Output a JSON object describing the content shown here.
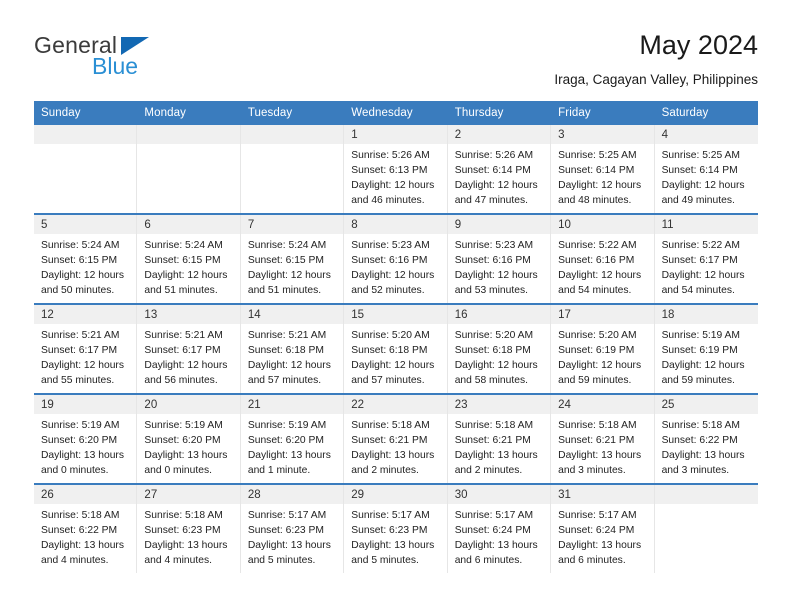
{
  "logo": {
    "line1": "General",
    "line2": "Blue",
    "triangle_color": "#1268b3",
    "blue_color": "#2a8fd4"
  },
  "header": {
    "title": "May 2024",
    "subtitle": "Iraga, Cagayan Valley, Philippines"
  },
  "theme": {
    "header_blue": "#3a7cbe",
    "date_band_gray": "#f0f0f0",
    "cell_border": "#e6e6e6"
  },
  "weekdays": [
    "Sunday",
    "Monday",
    "Tuesday",
    "Wednesday",
    "Thursday",
    "Friday",
    "Saturday"
  ],
  "weeks": [
    [
      {
        "day": "",
        "empty": true
      },
      {
        "day": "",
        "empty": true
      },
      {
        "day": "",
        "empty": true
      },
      {
        "day": "1",
        "sunrise": "Sunrise: 5:26 AM",
        "sunset": "Sunset: 6:13 PM",
        "daylight1": "Daylight: 12 hours",
        "daylight2": "and 46 minutes."
      },
      {
        "day": "2",
        "sunrise": "Sunrise: 5:26 AM",
        "sunset": "Sunset: 6:14 PM",
        "daylight1": "Daylight: 12 hours",
        "daylight2": "and 47 minutes."
      },
      {
        "day": "3",
        "sunrise": "Sunrise: 5:25 AM",
        "sunset": "Sunset: 6:14 PM",
        "daylight1": "Daylight: 12 hours",
        "daylight2": "and 48 minutes."
      },
      {
        "day": "4",
        "sunrise": "Sunrise: 5:25 AM",
        "sunset": "Sunset: 6:14 PM",
        "daylight1": "Daylight: 12 hours",
        "daylight2": "and 49 minutes."
      }
    ],
    [
      {
        "day": "5",
        "sunrise": "Sunrise: 5:24 AM",
        "sunset": "Sunset: 6:15 PM",
        "daylight1": "Daylight: 12 hours",
        "daylight2": "and 50 minutes."
      },
      {
        "day": "6",
        "sunrise": "Sunrise: 5:24 AM",
        "sunset": "Sunset: 6:15 PM",
        "daylight1": "Daylight: 12 hours",
        "daylight2": "and 51 minutes."
      },
      {
        "day": "7",
        "sunrise": "Sunrise: 5:24 AM",
        "sunset": "Sunset: 6:15 PM",
        "daylight1": "Daylight: 12 hours",
        "daylight2": "and 51 minutes."
      },
      {
        "day": "8",
        "sunrise": "Sunrise: 5:23 AM",
        "sunset": "Sunset: 6:16 PM",
        "daylight1": "Daylight: 12 hours",
        "daylight2": "and 52 minutes."
      },
      {
        "day": "9",
        "sunrise": "Sunrise: 5:23 AM",
        "sunset": "Sunset: 6:16 PM",
        "daylight1": "Daylight: 12 hours",
        "daylight2": "and 53 minutes."
      },
      {
        "day": "10",
        "sunrise": "Sunrise: 5:22 AM",
        "sunset": "Sunset: 6:16 PM",
        "daylight1": "Daylight: 12 hours",
        "daylight2": "and 54 minutes."
      },
      {
        "day": "11",
        "sunrise": "Sunrise: 5:22 AM",
        "sunset": "Sunset: 6:17 PM",
        "daylight1": "Daylight: 12 hours",
        "daylight2": "and 54 minutes."
      }
    ],
    [
      {
        "day": "12",
        "sunrise": "Sunrise: 5:21 AM",
        "sunset": "Sunset: 6:17 PM",
        "daylight1": "Daylight: 12 hours",
        "daylight2": "and 55 minutes."
      },
      {
        "day": "13",
        "sunrise": "Sunrise: 5:21 AM",
        "sunset": "Sunset: 6:17 PM",
        "daylight1": "Daylight: 12 hours",
        "daylight2": "and 56 minutes."
      },
      {
        "day": "14",
        "sunrise": "Sunrise: 5:21 AM",
        "sunset": "Sunset: 6:18 PM",
        "daylight1": "Daylight: 12 hours",
        "daylight2": "and 57 minutes."
      },
      {
        "day": "15",
        "sunrise": "Sunrise: 5:20 AM",
        "sunset": "Sunset: 6:18 PM",
        "daylight1": "Daylight: 12 hours",
        "daylight2": "and 57 minutes."
      },
      {
        "day": "16",
        "sunrise": "Sunrise: 5:20 AM",
        "sunset": "Sunset: 6:18 PM",
        "daylight1": "Daylight: 12 hours",
        "daylight2": "and 58 minutes."
      },
      {
        "day": "17",
        "sunrise": "Sunrise: 5:20 AM",
        "sunset": "Sunset: 6:19 PM",
        "daylight1": "Daylight: 12 hours",
        "daylight2": "and 59 minutes."
      },
      {
        "day": "18",
        "sunrise": "Sunrise: 5:19 AM",
        "sunset": "Sunset: 6:19 PM",
        "daylight1": "Daylight: 12 hours",
        "daylight2": "and 59 minutes."
      }
    ],
    [
      {
        "day": "19",
        "sunrise": "Sunrise: 5:19 AM",
        "sunset": "Sunset: 6:20 PM",
        "daylight1": "Daylight: 13 hours",
        "daylight2": "and 0 minutes."
      },
      {
        "day": "20",
        "sunrise": "Sunrise: 5:19 AM",
        "sunset": "Sunset: 6:20 PM",
        "daylight1": "Daylight: 13 hours",
        "daylight2": "and 0 minutes."
      },
      {
        "day": "21",
        "sunrise": "Sunrise: 5:19 AM",
        "sunset": "Sunset: 6:20 PM",
        "daylight1": "Daylight: 13 hours",
        "daylight2": "and 1 minute."
      },
      {
        "day": "22",
        "sunrise": "Sunrise: 5:18 AM",
        "sunset": "Sunset: 6:21 PM",
        "daylight1": "Daylight: 13 hours",
        "daylight2": "and 2 minutes."
      },
      {
        "day": "23",
        "sunrise": "Sunrise: 5:18 AM",
        "sunset": "Sunset: 6:21 PM",
        "daylight1": "Daylight: 13 hours",
        "daylight2": "and 2 minutes."
      },
      {
        "day": "24",
        "sunrise": "Sunrise: 5:18 AM",
        "sunset": "Sunset: 6:21 PM",
        "daylight1": "Daylight: 13 hours",
        "daylight2": "and 3 minutes."
      },
      {
        "day": "25",
        "sunrise": "Sunrise: 5:18 AM",
        "sunset": "Sunset: 6:22 PM",
        "daylight1": "Daylight: 13 hours",
        "daylight2": "and 3 minutes."
      }
    ],
    [
      {
        "day": "26",
        "sunrise": "Sunrise: 5:18 AM",
        "sunset": "Sunset: 6:22 PM",
        "daylight1": "Daylight: 13 hours",
        "daylight2": "and 4 minutes."
      },
      {
        "day": "27",
        "sunrise": "Sunrise: 5:18 AM",
        "sunset": "Sunset: 6:23 PM",
        "daylight1": "Daylight: 13 hours",
        "daylight2": "and 4 minutes."
      },
      {
        "day": "28",
        "sunrise": "Sunrise: 5:17 AM",
        "sunset": "Sunset: 6:23 PM",
        "daylight1": "Daylight: 13 hours",
        "daylight2": "and 5 minutes."
      },
      {
        "day": "29",
        "sunrise": "Sunrise: 5:17 AM",
        "sunset": "Sunset: 6:23 PM",
        "daylight1": "Daylight: 13 hours",
        "daylight2": "and 5 minutes."
      },
      {
        "day": "30",
        "sunrise": "Sunrise: 5:17 AM",
        "sunset": "Sunset: 6:24 PM",
        "daylight1": "Daylight: 13 hours",
        "daylight2": "and 6 minutes."
      },
      {
        "day": "31",
        "sunrise": "Sunrise: 5:17 AM",
        "sunset": "Sunset: 6:24 PM",
        "daylight1": "Daylight: 13 hours",
        "daylight2": "and 6 minutes."
      },
      {
        "day": "",
        "empty": true
      }
    ]
  ]
}
